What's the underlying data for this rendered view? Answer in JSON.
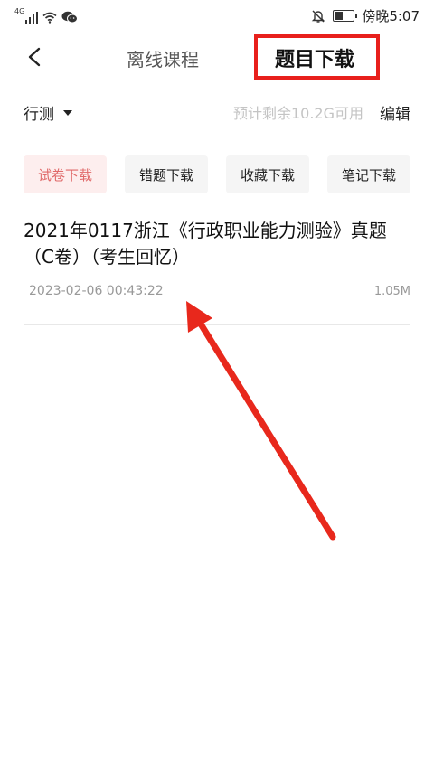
{
  "status_bar": {
    "network": "4G",
    "time": "傍晚5:07",
    "battery_level": 0.5
  },
  "header": {
    "tab_offline_course": "离线课程",
    "tab_question_download": "题目下载"
  },
  "subbar": {
    "subject": "行测",
    "storage": "预计剩余10.2G可用",
    "edit": "编辑"
  },
  "chips": [
    {
      "label": "试卷下载",
      "active": true
    },
    {
      "label": "错题下载",
      "active": false
    },
    {
      "label": "收藏下载",
      "active": false
    },
    {
      "label": "笔记下载",
      "active": false
    }
  ],
  "items": [
    {
      "title": "2021年0117浙江《行政职业能力测验》真题（C卷）（考生回忆）",
      "date": "2023-02-06 00:43:22",
      "size": "1.05M"
    }
  ],
  "colors": {
    "highlight": "#e8201c",
    "chip_active_text": "#e06a6a",
    "chip_active_bg": "#fdeeee"
  }
}
